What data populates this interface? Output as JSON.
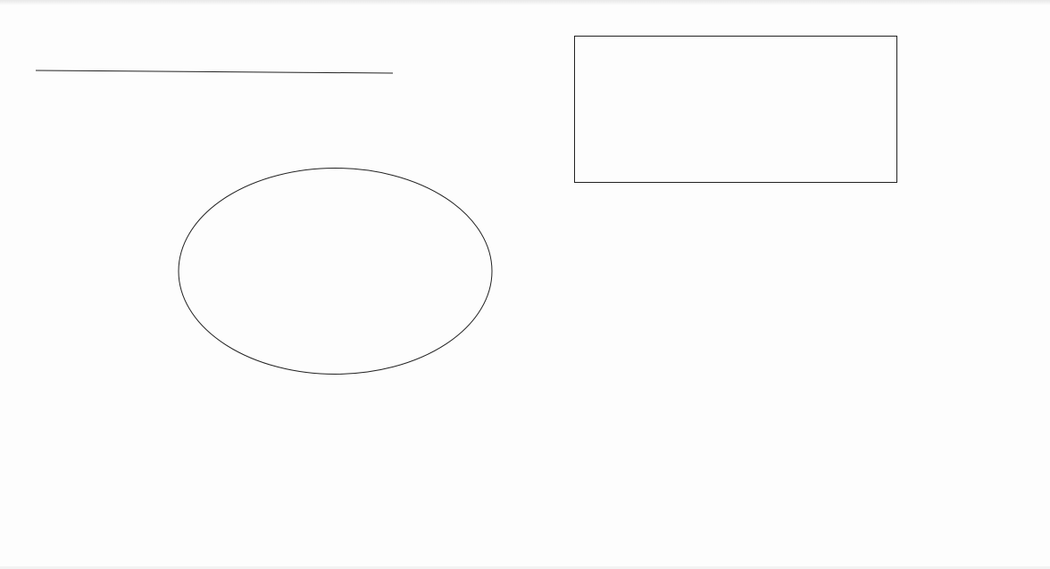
{
  "canvas": {
    "background_color": "#fdfdfd",
    "stroke_color": "#222222",
    "fill": "none",
    "shapes": [
      {
        "kind": "line",
        "name": "line-shape"
      },
      {
        "kind": "rectangle",
        "name": "rectangle-shape"
      },
      {
        "kind": "ellipse",
        "name": "ellipse-shape"
      }
    ]
  }
}
